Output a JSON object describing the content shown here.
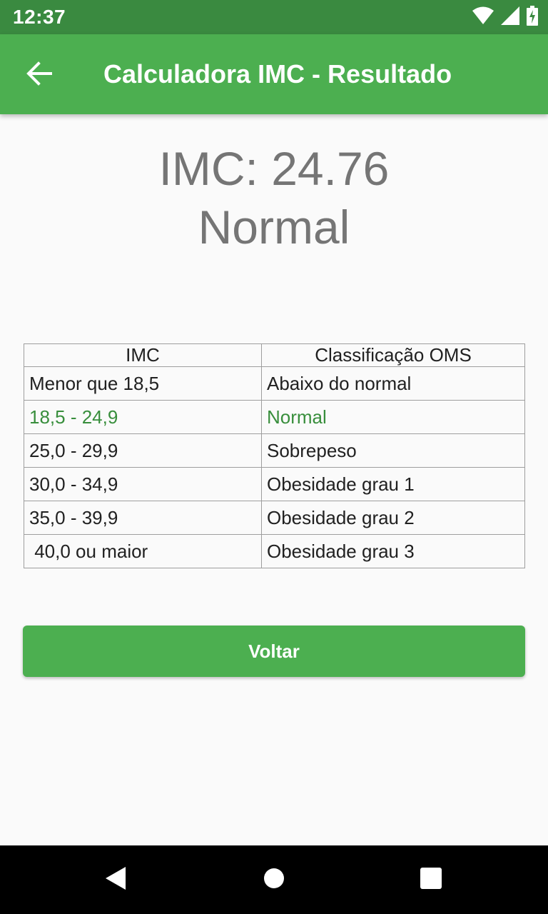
{
  "status_bar": {
    "time": "12:37",
    "icons": [
      "wifi-icon",
      "signal-icon",
      "battery-charging-icon"
    ]
  },
  "app_bar": {
    "title": "Calculadora IMC - Resultado",
    "back_icon": "arrow-back-icon"
  },
  "result": {
    "imc_text": "IMC: 24.76",
    "classification": "Normal"
  },
  "table": {
    "headers": [
      "IMC",
      "Classificação OMS"
    ],
    "rows": [
      {
        "imc": "Menor que 18,5",
        "classificacao": "Abaixo do normal",
        "highlighted": false
      },
      {
        "imc": "18,5 - 24,9",
        "classificacao": "Normal",
        "highlighted": true
      },
      {
        "imc": "25,0 - 29,9",
        "classificacao": "Sobrepeso",
        "highlighted": false
      },
      {
        "imc": "30,0 - 34,9",
        "classificacao": "Obesidade grau 1",
        "highlighted": false
      },
      {
        "imc": "35,0 - 39,9",
        "classificacao": "Obesidade grau 2",
        "highlighted": false
      },
      {
        "imc": " 40,0 ou maior",
        "classificacao": "Obesidade grau 3",
        "highlighted": false
      }
    ]
  },
  "actions": {
    "back_label": "Voltar"
  },
  "colors": {
    "primary": "#4caf50",
    "status_bar": "#3a8a40",
    "highlight": "#388e3c",
    "result_text": "#757575"
  },
  "nav_bar": {
    "icons": [
      "back-triangle-icon",
      "home-circle-icon",
      "recents-square-icon"
    ]
  }
}
